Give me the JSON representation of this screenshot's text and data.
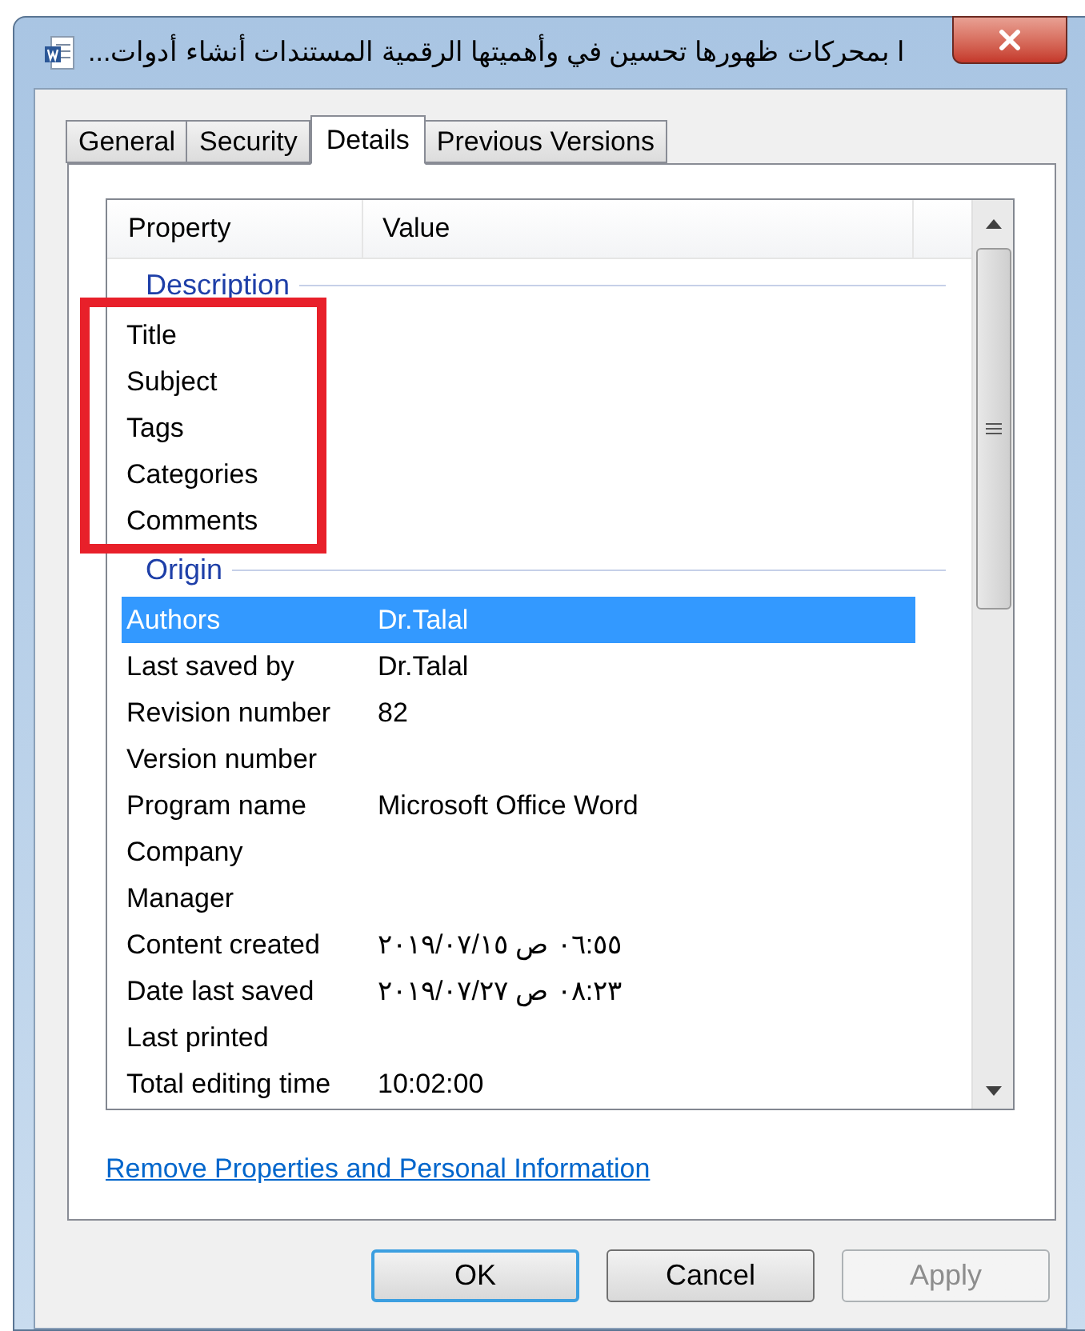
{
  "window": {
    "title": "ا بمحركات ظهورها تحسين في وأهميتها الرقمية المستندات أنشاء أدوات..."
  },
  "tabs": [
    {
      "label": "General",
      "selected": false
    },
    {
      "label": "Security",
      "selected": false
    },
    {
      "label": "Details",
      "selected": true
    },
    {
      "label": "Previous Versions",
      "selected": false
    }
  ],
  "table": {
    "columns": [
      "Property",
      "Value"
    ],
    "groups": [
      {
        "label": "Description",
        "highlighted": true,
        "rows": [
          {
            "property": "Title",
            "value": "",
            "selected": false
          },
          {
            "property": "Subject",
            "value": "",
            "selected": false
          },
          {
            "property": "Tags",
            "value": "",
            "selected": false
          },
          {
            "property": "Categories",
            "value": "",
            "selected": false
          },
          {
            "property": "Comments",
            "value": "",
            "selected": false
          }
        ]
      },
      {
        "label": "Origin",
        "highlighted": false,
        "rows": [
          {
            "property": "Authors",
            "value": "Dr.Talal",
            "selected": true
          },
          {
            "property": "Last saved by",
            "value": "Dr.Talal",
            "selected": false
          },
          {
            "property": "Revision number",
            "value": "82",
            "selected": false
          },
          {
            "property": "Version number",
            "value": "",
            "selected": false
          },
          {
            "property": "Program name",
            "value": "Microsoft Office Word",
            "selected": false
          },
          {
            "property": "Company",
            "value": "",
            "selected": false
          },
          {
            "property": "Manager",
            "value": "",
            "selected": false
          },
          {
            "property": "Content created",
            "value": "٠٦:٥٥ ص ٢٠١٩/٠٧/١٥",
            "selected": false
          },
          {
            "property": "Date last saved",
            "value": "٠٨:٢٣ ص ٢٠١٩/٠٧/٢٧",
            "selected": false
          },
          {
            "property": "Last printed",
            "value": "",
            "selected": false
          },
          {
            "property": "Total editing time",
            "value": "10:02:00",
            "selected": false
          }
        ]
      }
    ]
  },
  "link": "Remove Properties and Personal Information",
  "buttons": [
    {
      "label": "OK",
      "default": true,
      "disabled": false
    },
    {
      "label": "Cancel",
      "default": false,
      "disabled": false
    },
    {
      "label": "Apply",
      "default": false,
      "disabled": true
    }
  ]
}
